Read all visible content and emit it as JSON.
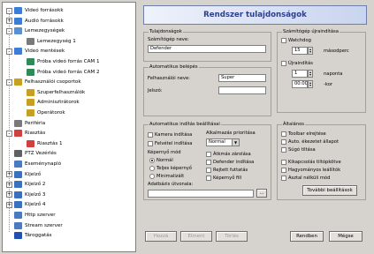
{
  "tree": {
    "items": [
      {
        "label": "Videó forrásokk",
        "icon_color": "#3b7dd8",
        "expander": "-",
        "level": 0
      },
      {
        "label": "Audió forrásokk",
        "icon_color": "#3b7dd8",
        "expander": "+",
        "level": 0
      },
      {
        "label": "Lemezegységek",
        "icon_color": "#5a8fd0",
        "expander": "-",
        "level": 0
      },
      {
        "label": "Lemezegység 1",
        "icon_color": "#7a7a7a",
        "expander": "",
        "level": 1
      },
      {
        "label": "Videó mentések",
        "icon_color": "#3b7dd8",
        "expander": "-",
        "level": 0
      },
      {
        "label": "Próba videó forrás CAM 1",
        "icon_color": "#2e8b57",
        "expander": "",
        "level": 1
      },
      {
        "label": "Próba videó forrás CAM 2",
        "icon_color": "#2e8b57",
        "expander": "",
        "level": 1
      },
      {
        "label": "Felhasználói csoportok",
        "icon_color": "#c8a020",
        "expander": "-",
        "level": 0
      },
      {
        "label": "Szuperfelhasználók",
        "icon_color": "#c8a020",
        "expander": "",
        "level": 1
      },
      {
        "label": "Adminisztrátorok",
        "icon_color": "#c8a020",
        "expander": "",
        "level": 1
      },
      {
        "label": "Operátorok",
        "icon_color": "#c8a020",
        "expander": "",
        "level": 1
      },
      {
        "label": "Periféria",
        "icon_color": "#7a7a7a",
        "expander": "",
        "level": 0
      },
      {
        "label": "Riasztás",
        "icon_color": "#d04040",
        "expander": "-",
        "level": 0
      },
      {
        "label": "Riasztás 1",
        "icon_color": "#d04040",
        "expander": "",
        "level": 1
      },
      {
        "label": "PTZ Vezérlés",
        "icon_color": "#606060",
        "expander": "",
        "level": 0
      },
      {
        "label": "Eseménynapló",
        "icon_color": "#4a7ac0",
        "expander": "",
        "level": 0
      },
      {
        "label": "Kijelző",
        "icon_color": "#3b6fc0",
        "expander": "+",
        "level": 0
      },
      {
        "label": "Kijelző 2",
        "icon_color": "#3b6fc0",
        "expander": "+",
        "level": 0
      },
      {
        "label": "Kijelző 3",
        "icon_color": "#3b6fc0",
        "expander": "+",
        "level": 0
      },
      {
        "label": "Kijelző 4",
        "icon_color": "#3b6fc0",
        "expander": "+",
        "level": 0
      },
      {
        "label": "Http szerver",
        "icon_color": "#4a7ac0",
        "expander": "",
        "level": 0
      },
      {
        "label": "Stream szerver",
        "icon_color": "#4a7ac0",
        "expander": "",
        "level": 0
      },
      {
        "label": "Tároggatás",
        "icon_color": "#2050b0",
        "expander": "",
        "level": 0
      }
    ]
  },
  "header": {
    "title": "Rendszer tulajdonságok"
  },
  "tulajdonsagok": {
    "title": "Tulajdonságok",
    "name_label": "Számítógép neve:",
    "name_value": "Defender"
  },
  "auto_login": {
    "title": "Automatikus belépés",
    "user_label": "Felhasználói neve:",
    "user_value": "Super",
    "password_label": "Jelszó:",
    "password_value": ""
  },
  "auto_start": {
    "title": "Automatikus indítás beállításai",
    "camera_check": "Kamera indítása",
    "record_check": "Felvétel indítása",
    "priority_label": "Alkalmazás prioritása",
    "priority_value": "Normal",
    "display_mode_label": "Képernyő mód",
    "mode_normal": "Normál",
    "mode_full": "Teljes képernyő",
    "mode_min": "Minimalizált",
    "alarm_check": "Átkmás zárolása",
    "defender_check": "Defender indítása",
    "hide_tasks_check": "Rejtett futtatás",
    "screen_lock_check": "Képernyő fill",
    "db_path_label": "Adatbázis útvonala:",
    "db_path_value": "",
    "browse_label": "..."
  },
  "shutdown": {
    "title": "Számítógép újraindítása",
    "watchdog_label": "Watchdog",
    "watchdog_value": "15",
    "watchdog_unit": "másodperc",
    "daily_label": "Újraindítás",
    "daily_value": "1",
    "daily_unit": "naponta",
    "time_value": "00:00",
    "time_unit": "-kor"
  },
  "general": {
    "title": "Általános",
    "toolbar_check": "Toolbar elrejtése",
    "auto_check": "Auto. ékezetet állapot",
    "help_check": "Súgó tiltása",
    "small_icons_check": "Kikapcsolás tiltópkötve",
    "tooltip_check": "Hagyományos leállítók",
    "desktop_check": "Asztal nélküli mód",
    "more_button": "További beállítások"
  },
  "footer": {
    "buttons": [
      "Hozzá",
      "Elment",
      "Törlés"
    ],
    "ok": "Rendben",
    "cancel": "Mégse"
  }
}
